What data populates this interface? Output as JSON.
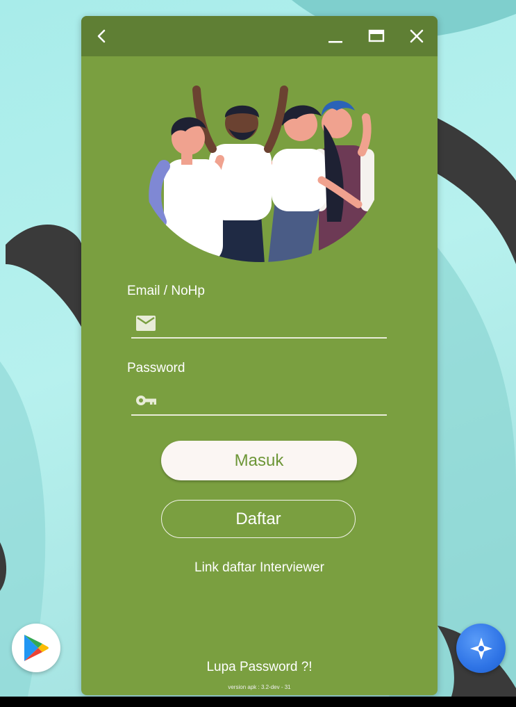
{
  "window": {
    "controls": [
      "back-icon",
      "minimize-icon",
      "maximize-icon",
      "close-icon"
    ]
  },
  "form": {
    "email_label": "Email / NoHp",
    "email_value": "",
    "email_icon": "mail-icon",
    "password_label": "Password",
    "password_value": "",
    "password_icon": "key-icon"
  },
  "actions": {
    "login_label": "Masuk",
    "register_label": "Daftar",
    "interviewer_link": "Link daftar Interviewer",
    "forgot_password": "Lupa Password ?!"
  },
  "footer": {
    "version": "version apk : 3.2-dev - 31"
  },
  "dock": {
    "left_icon": "play-store-icon",
    "right_icon": "assistant-icon"
  },
  "colors": {
    "window_bg": "#7a9f40",
    "titlebar_bg": "#5f7f34",
    "primary_button_bg": "#fbf6f3",
    "primary_button_text": "#6d9637"
  }
}
